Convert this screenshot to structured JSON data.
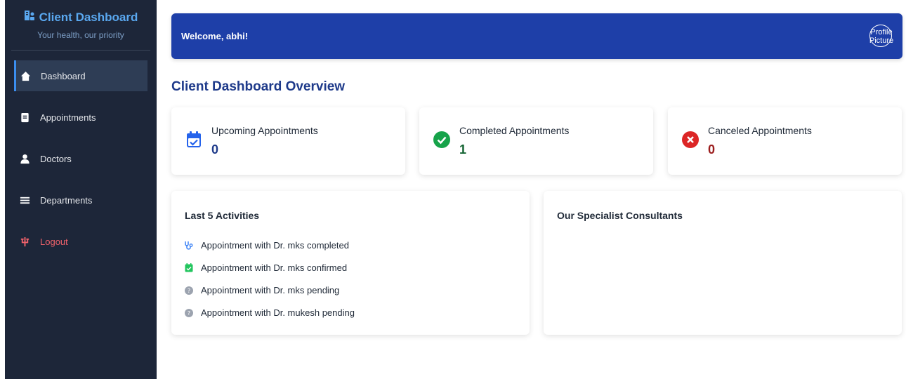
{
  "brand": {
    "title": "Client Dashboard",
    "subtitle": "Your health, our priority",
    "icon": "hospital-user-icon"
  },
  "sidebar": {
    "items": [
      {
        "label": "Dashboard",
        "icon": "home-icon",
        "active": true
      },
      {
        "label": "Appointments",
        "icon": "file-icon",
        "active": false
      },
      {
        "label": "Doctors",
        "icon": "user-doctor-icon",
        "active": false
      },
      {
        "label": "Departments",
        "icon": "bars-icon",
        "active": false
      },
      {
        "label": "Logout",
        "icon": "logout-icon",
        "active": false
      }
    ]
  },
  "header": {
    "welcome": "Welcome, abhi!",
    "profile_alt": "Profile Picture"
  },
  "overview": {
    "title": "Client Dashboard Overview"
  },
  "stats": [
    {
      "label": "Upcoming Appointments",
      "value": "0",
      "icon": "calendar-check-icon",
      "color": "#2563eb"
    },
    {
      "label": "Completed Appointments",
      "value": "1",
      "icon": "check-circle-icon",
      "color": "#16a34a"
    },
    {
      "label": "Canceled Appointments",
      "value": "0",
      "icon": "x-circle-icon",
      "color": "#dc2626"
    }
  ],
  "activities": {
    "title": "Last 5 Activities",
    "items": [
      {
        "text": "Appointment with Dr. mks completed",
        "icon": "stethoscope-icon"
      },
      {
        "text": "Appointment with Dr. mks confirmed",
        "icon": "calendar-check-icon"
      },
      {
        "text": "Appointment with Dr. mks pending",
        "icon": "question-circle-icon"
      },
      {
        "text": "Appointment with Dr. mukesh pending",
        "icon": "question-circle-icon"
      }
    ]
  },
  "specialists": {
    "title": "Our Specialist Consultants"
  },
  "colors": {
    "sidebar_bg": "#1d2639",
    "header_bg": "#1e3fa8",
    "accent": "#3b8ef0",
    "logout": "#f0626b"
  }
}
